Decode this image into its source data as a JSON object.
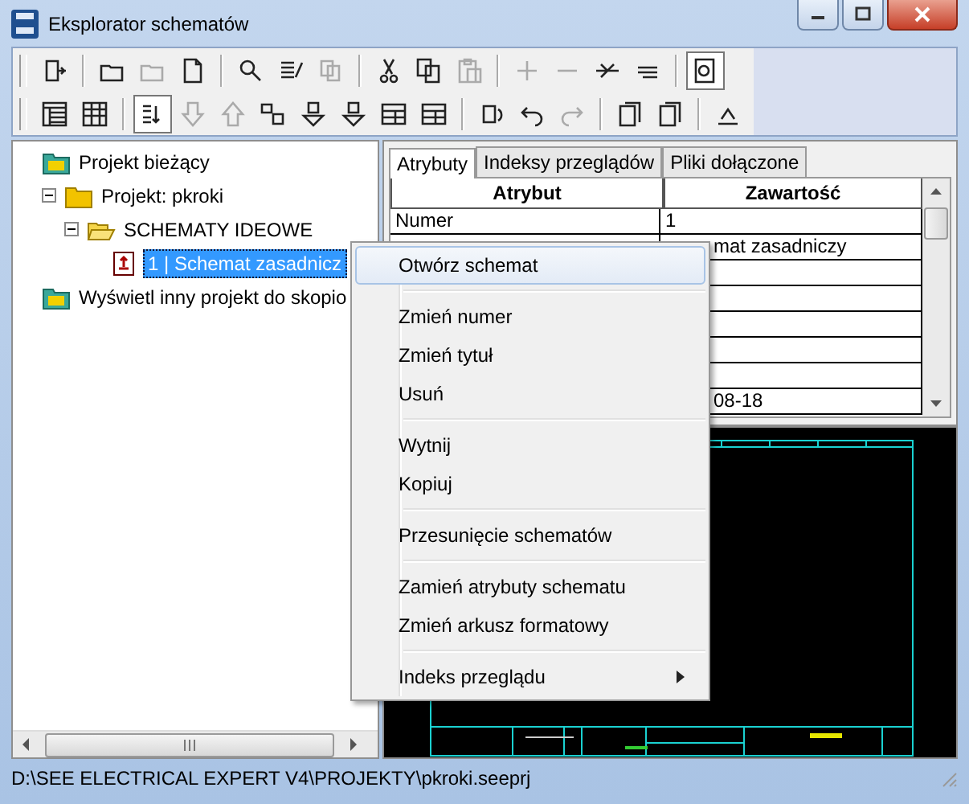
{
  "window": {
    "title": "Eksplorator schematów"
  },
  "toolbars": [
    {
      "groups": [
        [
          {
            "kind": "exit",
            "disabled": false,
            "pressed": false
          }
        ],
        [
          {
            "kind": "folder",
            "disabled": false,
            "pressed": false
          },
          {
            "kind": "folder",
            "disabled": true,
            "pressed": false
          },
          {
            "kind": "document",
            "disabled": false,
            "pressed": false
          }
        ],
        [
          {
            "kind": "magnifier",
            "disabled": false,
            "pressed": false
          },
          {
            "kind": "list",
            "disabled": false,
            "pressed": false
          },
          {
            "kind": "pages",
            "disabled": true,
            "pressed": false
          }
        ],
        [
          {
            "kind": "scissors",
            "disabled": false,
            "pressed": false
          },
          {
            "kind": "copy",
            "disabled": false,
            "pressed": false
          },
          {
            "kind": "clipboard",
            "disabled": true,
            "pressed": false
          }
        ],
        [
          {
            "kind": "plus",
            "disabled": true,
            "pressed": false
          },
          {
            "kind": "minus",
            "disabled": true,
            "pressed": false
          },
          {
            "kind": "branch",
            "disabled": false,
            "pressed": false
          },
          {
            "kind": "lines",
            "disabled": false,
            "pressed": false
          }
        ],
        [
          {
            "kind": "preview",
            "disabled": false,
            "pressed": true
          }
        ]
      ]
    },
    {
      "groups": [
        [
          {
            "kind": "panel",
            "disabled": false,
            "pressed": false
          },
          {
            "kind": "columns",
            "disabled": false,
            "pressed": false
          }
        ],
        [
          {
            "kind": "sort",
            "disabled": false,
            "pressed": true
          },
          {
            "kind": "arrow-down",
            "disabled": true,
            "pressed": false
          },
          {
            "kind": "arrow-up",
            "disabled": true,
            "pressed": false
          },
          {
            "kind": "renumber",
            "disabled": false,
            "pressed": false
          },
          {
            "kind": "stamp",
            "disabled": false,
            "pressed": false
          },
          {
            "kind": "stamp",
            "disabled": false,
            "pressed": false
          },
          {
            "kind": "rows",
            "disabled": false,
            "pressed": false
          },
          {
            "kind": "rows",
            "disabled": false,
            "pressed": false
          }
        ],
        [
          {
            "kind": "refresh",
            "disabled": false,
            "pressed": false
          },
          {
            "kind": "undo",
            "disabled": false,
            "pressed": false
          },
          {
            "kind": "redo",
            "disabled": true,
            "pressed": false
          }
        ],
        [
          {
            "kind": "stack",
            "disabled": false,
            "pressed": false
          },
          {
            "kind": "stack",
            "disabled": false,
            "pressed": false
          }
        ],
        [
          {
            "kind": "caret",
            "disabled": false,
            "pressed": false
          }
        ]
      ]
    }
  ],
  "tree": [
    {
      "label": "Projekt bieżący",
      "kind": "project",
      "selected": false,
      "children": [
        {
          "label": "Projekt: pkroki",
          "kind": "folder",
          "selected": false,
          "expanded": true,
          "children": [
            {
              "label": "SCHEMATY IDEOWE",
              "kind": "open-folder",
              "selected": false,
              "expanded": true,
              "children": [
                {
                  "label": "1 | Schemat zasadnicz",
                  "kind": "sheet",
                  "selected": true
                }
              ]
            }
          ]
        }
      ]
    },
    {
      "label": "Wyświetl inny projekt do skopio",
      "kind": "project",
      "selected": false
    }
  ],
  "tabs": [
    {
      "label": "Atrybuty",
      "selected": true
    },
    {
      "label": "Indeksy przeglądów",
      "selected": false
    },
    {
      "label": "Pliki dołączone",
      "selected": false
    }
  ],
  "table": {
    "columns": [
      "Atrybut",
      "Zawartość"
    ],
    "rows": [
      {
        "attribute": "Numer",
        "value": "1",
        "covered": false
      },
      {
        "value": "mat zasadniczy",
        "covered": true
      },
      {},
      {},
      {},
      {},
      {},
      {
        "value": "08-18",
        "covered": true
      }
    ]
  },
  "context_menu": {
    "groups": [
      [
        {
          "label": "Otwórz schemat",
          "selected": true,
          "submenu": false
        }
      ],
      [
        {
          "label": "Zmień numer",
          "selected": false,
          "submenu": false
        },
        {
          "label": "Zmień tytuł",
          "selected": false,
          "submenu": false
        },
        {
          "label": "Usuń",
          "selected": false,
          "submenu": false
        }
      ],
      [
        {
          "label": "Wytnij",
          "selected": false,
          "submenu": false
        },
        {
          "label": "Kopiuj",
          "selected": false,
          "submenu": false
        }
      ],
      [
        {
          "label": "Przesunięcie schematów",
          "selected": false,
          "submenu": false
        }
      ],
      [
        {
          "label": "Zamień atrybuty schematu",
          "selected": false,
          "submenu": false
        },
        {
          "label": "Zmień arkusz formatowy",
          "selected": false,
          "submenu": false
        }
      ],
      [
        {
          "label": "Indeks przeglądu",
          "selected": false,
          "submenu": true
        }
      ]
    ]
  },
  "status_bar": {
    "path": "D:\\SEE ELECTRICAL EXPERT V4\\PROJEKTY\\pkroki.seeprj"
  }
}
